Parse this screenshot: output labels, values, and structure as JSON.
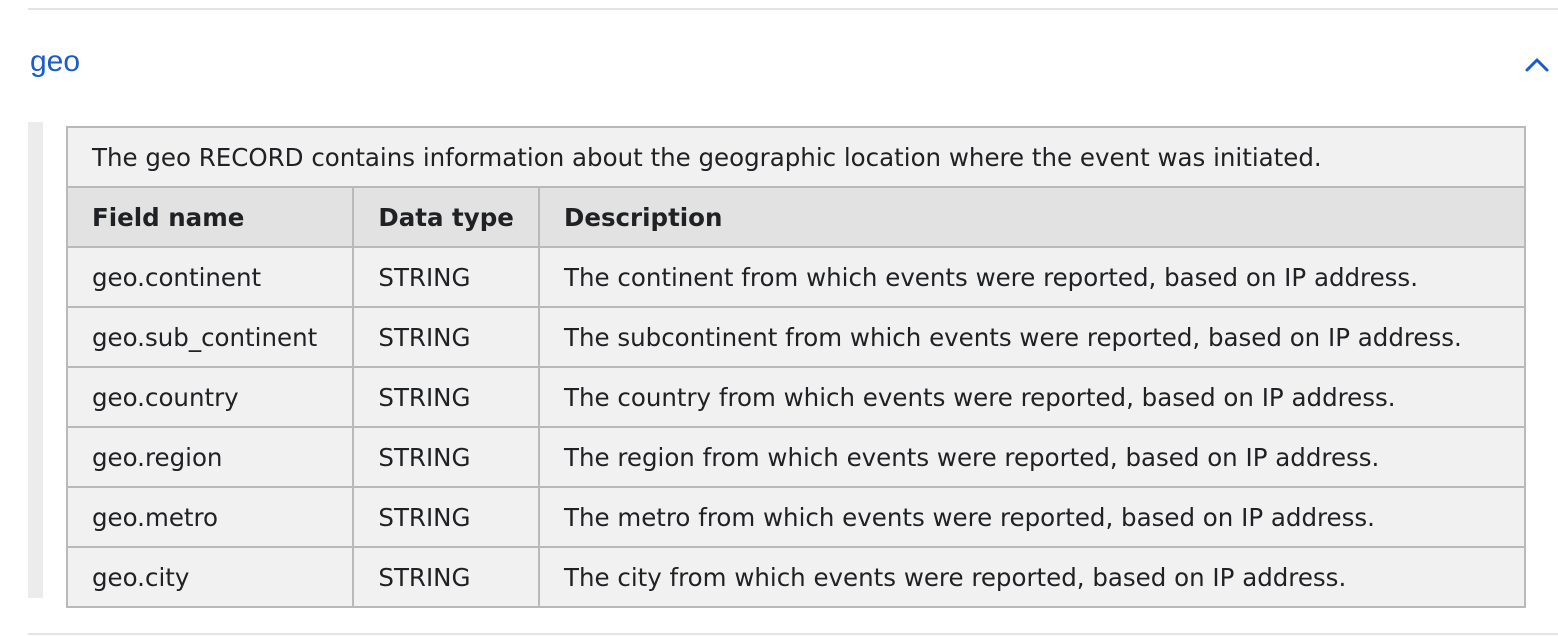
{
  "section": {
    "title": "geo",
    "expanded": true,
    "toggle_icon": "chevron-up-icon",
    "accent_color": "#1a5ccf"
  },
  "table": {
    "caption": "The geo RECORD contains information about the geographic location where the event was initiated.",
    "headers": [
      "Field name",
      "Data type",
      "Description"
    ],
    "rows": [
      [
        "geo.continent",
        "STRING",
        "The continent from which events were reported, based on IP address."
      ],
      [
        "geo.sub_continent",
        "STRING",
        "The subcontinent from which events were reported, based on IP address."
      ],
      [
        "geo.country",
        "STRING",
        "The country from which events were reported, based on IP address."
      ],
      [
        "geo.region",
        "STRING",
        "The region from which events were reported, based on IP address."
      ],
      [
        "geo.metro",
        "STRING",
        "The metro from which events were reported, based on IP address."
      ],
      [
        "geo.city",
        "STRING",
        "The city from which events were reported, based on IP address."
      ]
    ]
  }
}
